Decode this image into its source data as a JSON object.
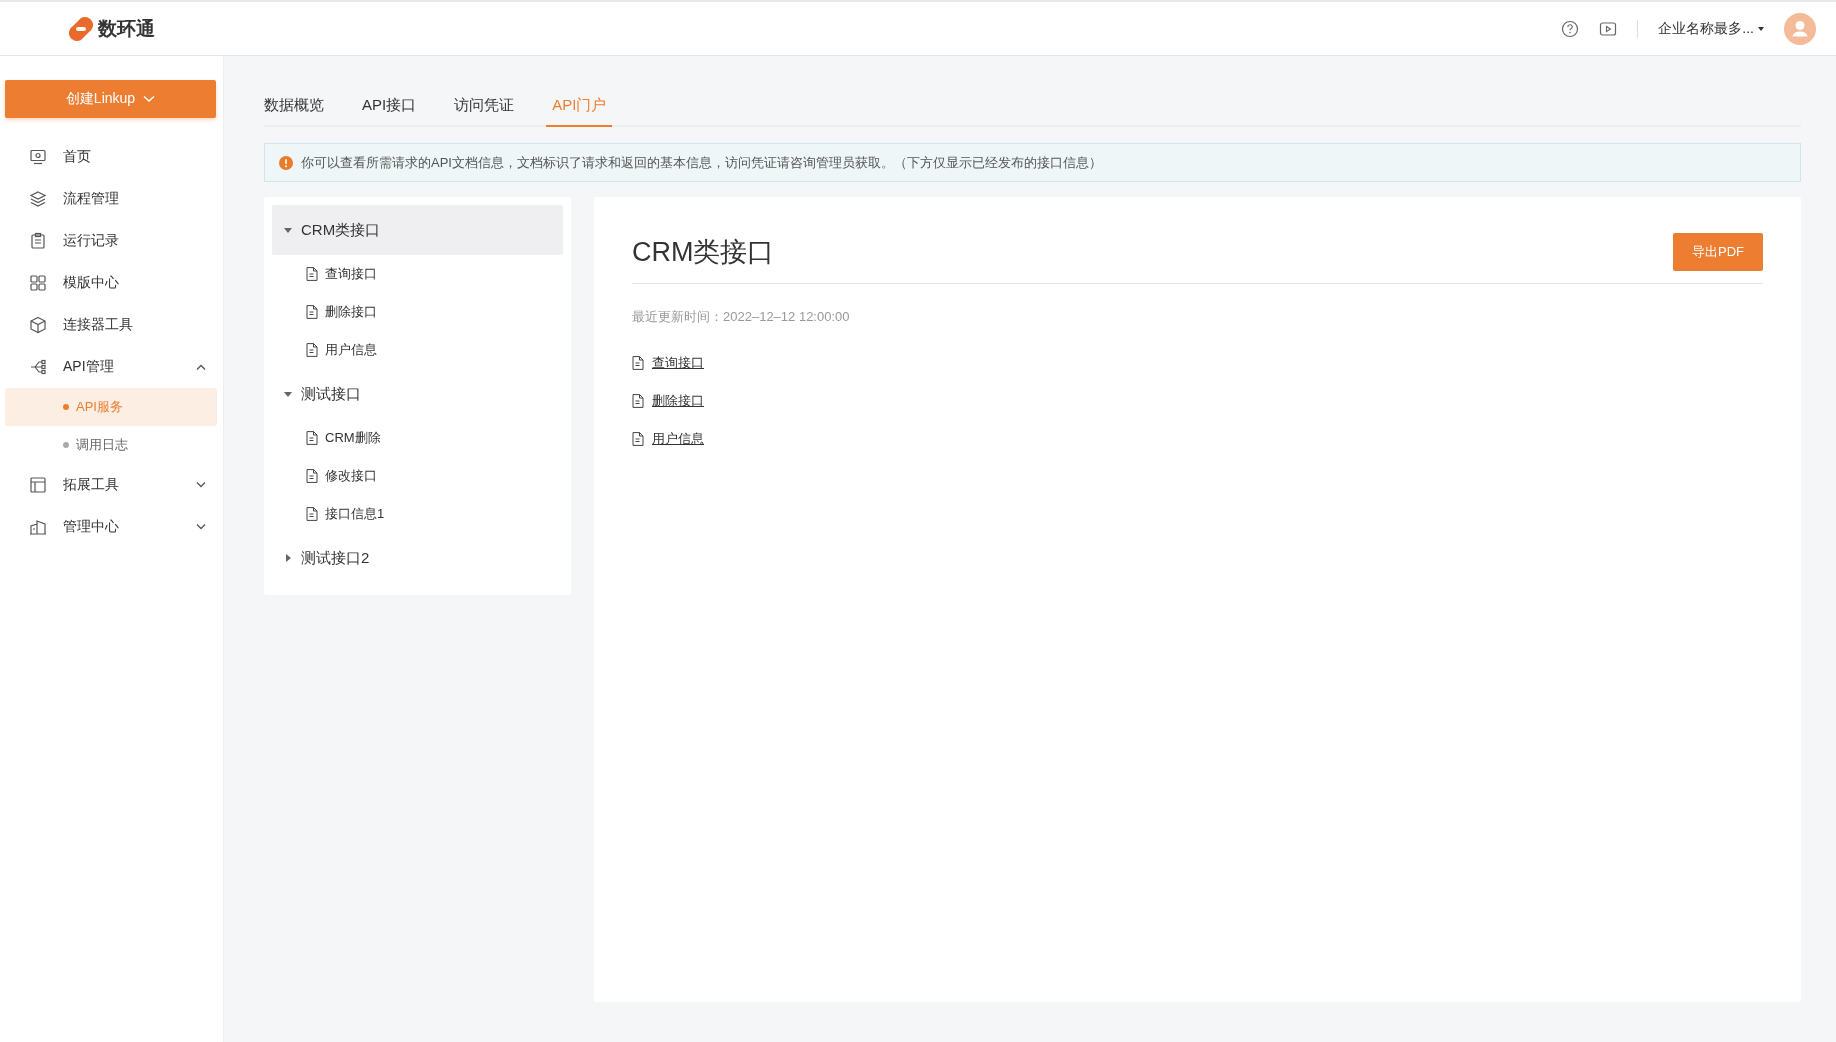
{
  "header": {
    "logo_text": "数环通",
    "company": "企业名称最多..."
  },
  "sidebar": {
    "create_button": "创建Linkup",
    "items": [
      {
        "label": "首页",
        "kind": "link",
        "selected": false
      },
      {
        "label": "流程管理",
        "kind": "link",
        "selected": false
      },
      {
        "label": "运行记录",
        "kind": "link",
        "selected": false
      },
      {
        "label": "模版中心",
        "kind": "link",
        "selected": false
      },
      {
        "label": "连接器工具",
        "kind": "link",
        "selected": false
      },
      {
        "label": "API管理",
        "kind": "group",
        "selected": false,
        "expanded": true,
        "children": [
          {
            "label": "API服务",
            "selected": true
          },
          {
            "label": "调用日志",
            "selected": false
          }
        ]
      },
      {
        "label": "拓展工具",
        "kind": "group",
        "selected": false,
        "expanded": false
      },
      {
        "label": "管理中心",
        "kind": "group",
        "selected": false,
        "expanded": false
      }
    ]
  },
  "tabs": [
    {
      "label": "数据概览",
      "selected": false
    },
    {
      "label": "API接口",
      "selected": false
    },
    {
      "label": "访问凭证",
      "selected": false
    },
    {
      "label": "API门户",
      "selected": true
    }
  ],
  "notice": "你可以查看所需请求的API文档信息，文档标识了请求和返回的基本信息，访问凭证请咨询管理员获取。（下方仅显示已经发布的接口信息）",
  "tree": [
    {
      "label": "CRM类接口",
      "selected": true,
      "expanded": true,
      "children": [
        {
          "label": "查询接口",
          "selected": false
        },
        {
          "label": "删除接口",
          "selected": false
        },
        {
          "label": "用户信息",
          "selected": false
        }
      ]
    },
    {
      "label": "测试接口",
      "selected": false,
      "expanded": true,
      "children": [
        {
          "label": "CRM删除",
          "selected": false
        },
        {
          "label": "修改接口",
          "selected": false
        },
        {
          "label": "接口信息1",
          "selected": false
        }
      ]
    },
    {
      "label": "测试接口2",
      "selected": false,
      "expanded": false
    }
  ],
  "doc": {
    "title": "CRM类接口",
    "export_button": "导出PDF",
    "updated": "最近更新时间：2022–12–12 12:00:00",
    "links": [
      "查询接口",
      "删除接口",
      "用户信息"
    ]
  }
}
